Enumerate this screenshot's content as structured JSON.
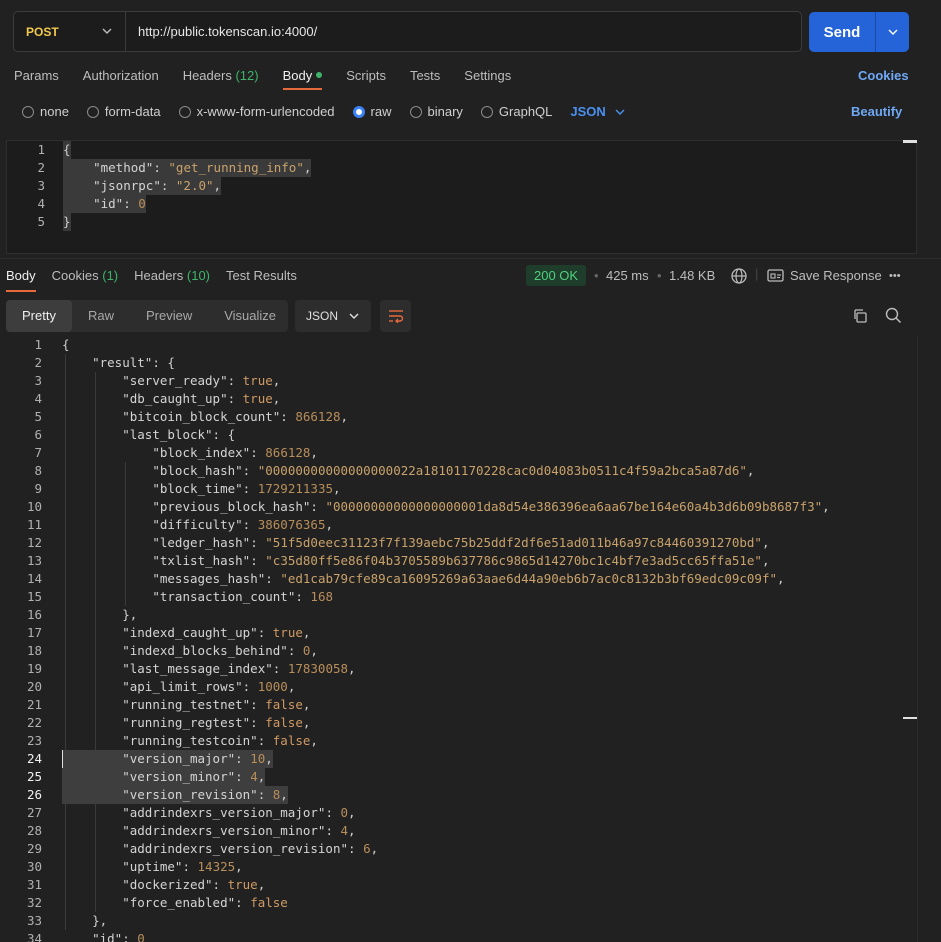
{
  "request": {
    "method": "POST",
    "url": "http://public.tokenscan.io:4000/",
    "send_label": "Send"
  },
  "request_tabs": {
    "params": "Params",
    "authorization": "Authorization",
    "headers": "Headers",
    "headers_count": "(12)",
    "body": "Body",
    "scripts": "Scripts",
    "tests": "Tests",
    "settings": "Settings",
    "cookies": "Cookies"
  },
  "body_types": {
    "none": "none",
    "form_data": "form-data",
    "urlencoded": "x-www-form-urlencoded",
    "raw": "raw",
    "binary": "binary",
    "graphql": "GraphQL",
    "selected_format": "JSON",
    "beautify": "Beautify"
  },
  "request_body": [
    {
      "n": "1",
      "t": "{"
    },
    {
      "n": "2",
      "k": "\"method\"",
      "v": "\"get_running_info\"",
      "vt": "s",
      "c": ","
    },
    {
      "n": "3",
      "k": "\"jsonrpc\"",
      "v": "\"2.0\"",
      "vt": "s",
      "c": ","
    },
    {
      "n": "4",
      "k": "\"id\"",
      "v": "0",
      "vt": "n",
      "c": ""
    },
    {
      "n": "5",
      "t": "}"
    }
  ],
  "response_tabs": {
    "body": "Body",
    "cookies": "Cookies",
    "cookies_count": "(1)",
    "headers": "Headers",
    "headers_count": "(10)",
    "test_results": "Test Results"
  },
  "response_meta": {
    "status": "200 OK",
    "time": "425 ms",
    "size": "1.48 KB",
    "save_response": "Save Response",
    "more": "•••"
  },
  "viewer": {
    "pretty": "Pretty",
    "raw": "Raw",
    "preview": "Preview",
    "visualize": "Visualize",
    "format": "JSON"
  },
  "response_body": [
    {
      "n": "1",
      "d": 0,
      "t": "{"
    },
    {
      "n": "2",
      "d": 1,
      "k": "\"result\"",
      "t": ": {"
    },
    {
      "n": "3",
      "d": 2,
      "k": "\"server_ready\"",
      "v": "true",
      "vt": "b",
      "c": ","
    },
    {
      "n": "4",
      "d": 2,
      "k": "\"db_caught_up\"",
      "v": "true",
      "vt": "b",
      "c": ","
    },
    {
      "n": "5",
      "d": 2,
      "k": "\"bitcoin_block_count\"",
      "v": "866128",
      "vt": "n",
      "c": ","
    },
    {
      "n": "6",
      "d": 2,
      "k": "\"last_block\"",
      "t": ": {"
    },
    {
      "n": "7",
      "d": 3,
      "k": "\"block_index\"",
      "v": "866128",
      "vt": "n",
      "c": ","
    },
    {
      "n": "8",
      "d": 3,
      "k": "\"block_hash\"",
      "v": "\"00000000000000000022a18101170228cac0d04083b0511c4f59a2bca5a87d6\"",
      "vt": "s",
      "c": ","
    },
    {
      "n": "9",
      "d": 3,
      "k": "\"block_time\"",
      "v": "1729211335",
      "vt": "n",
      "c": ","
    },
    {
      "n": "10",
      "d": 3,
      "k": "\"previous_block_hash\"",
      "v": "\"00000000000000000001da8d54e386396ea6aa67be164e60a4b3d6b09b8687f3\"",
      "vt": "s",
      "c": ","
    },
    {
      "n": "11",
      "d": 3,
      "k": "\"difficulty\"",
      "v": "386076365",
      "vt": "n",
      "c": ","
    },
    {
      "n": "12",
      "d": 3,
      "k": "\"ledger_hash\"",
      "v": "\"51f5d0eec31123f7f139aebc75b25ddf2df6e51ad011b46a97c84460391270bd\"",
      "vt": "s",
      "c": ","
    },
    {
      "n": "13",
      "d": 3,
      "k": "\"txlist_hash\"",
      "v": "\"c35d80ff5e86f04b3705589b637786c9865d14270bc1c4bf7e3ad5cc65ffa51e\"",
      "vt": "s",
      "c": ","
    },
    {
      "n": "14",
      "d": 3,
      "k": "\"messages_hash\"",
      "v": "\"ed1cab79cfe89ca16095269a63aae6d44a90eb6b7ac0c8132b3bf69edc09c09f\"",
      "vt": "s",
      "c": ","
    },
    {
      "n": "15",
      "d": 3,
      "k": "\"transaction_count\"",
      "v": "168",
      "vt": "n",
      "c": ""
    },
    {
      "n": "16",
      "d": 2,
      "t": "},"
    },
    {
      "n": "17",
      "d": 2,
      "k": "\"indexd_caught_up\"",
      "v": "true",
      "vt": "b",
      "c": ","
    },
    {
      "n": "18",
      "d": 2,
      "k": "\"indexd_blocks_behind\"",
      "v": "0",
      "vt": "n",
      "c": ","
    },
    {
      "n": "19",
      "d": 2,
      "k": "\"last_message_index\"",
      "v": "17830058",
      "vt": "n",
      "c": ","
    },
    {
      "n": "20",
      "d": 2,
      "k": "\"api_limit_rows\"",
      "v": "1000",
      "vt": "n",
      "c": ","
    },
    {
      "n": "21",
      "d": 2,
      "k": "\"running_testnet\"",
      "v": "false",
      "vt": "b",
      "c": ","
    },
    {
      "n": "22",
      "d": 2,
      "k": "\"running_regtest\"",
      "v": "false",
      "vt": "b",
      "c": ","
    },
    {
      "n": "23",
      "d": 2,
      "k": "\"running_testcoin\"",
      "v": "false",
      "vt": "b",
      "c": ","
    },
    {
      "n": "24",
      "d": 2,
      "k": "\"version_major\"",
      "v": "10",
      "vt": "n",
      "c": ",",
      "sel": true
    },
    {
      "n": "25",
      "d": 2,
      "k": "\"version_minor\"",
      "v": "4",
      "vt": "n",
      "c": ",",
      "sel": true
    },
    {
      "n": "26",
      "d": 2,
      "k": "\"version_revision\"",
      "v": "8",
      "vt": "n",
      "c": ",",
      "sel": true
    },
    {
      "n": "27",
      "d": 2,
      "k": "\"addrindexrs_version_major\"",
      "v": "0",
      "vt": "n",
      "c": ","
    },
    {
      "n": "28",
      "d": 2,
      "k": "\"addrindexrs_version_minor\"",
      "v": "4",
      "vt": "n",
      "c": ","
    },
    {
      "n": "29",
      "d": 2,
      "k": "\"addrindexrs_version_revision\"",
      "v": "6",
      "vt": "n",
      "c": ","
    },
    {
      "n": "30",
      "d": 2,
      "k": "\"uptime\"",
      "v": "14325",
      "vt": "n",
      "c": ","
    },
    {
      "n": "31",
      "d": 2,
      "k": "\"dockerized\"",
      "v": "true",
      "vt": "b",
      "c": ","
    },
    {
      "n": "32",
      "d": 2,
      "k": "\"force_enabled\"",
      "v": "false",
      "vt": "b",
      "c": ""
    },
    {
      "n": "33",
      "d": 1,
      "t": "},"
    },
    {
      "n": "34",
      "d": 1,
      "k": "\"id\"",
      "v": "0",
      "vt": "n",
      "c": ""
    }
  ]
}
